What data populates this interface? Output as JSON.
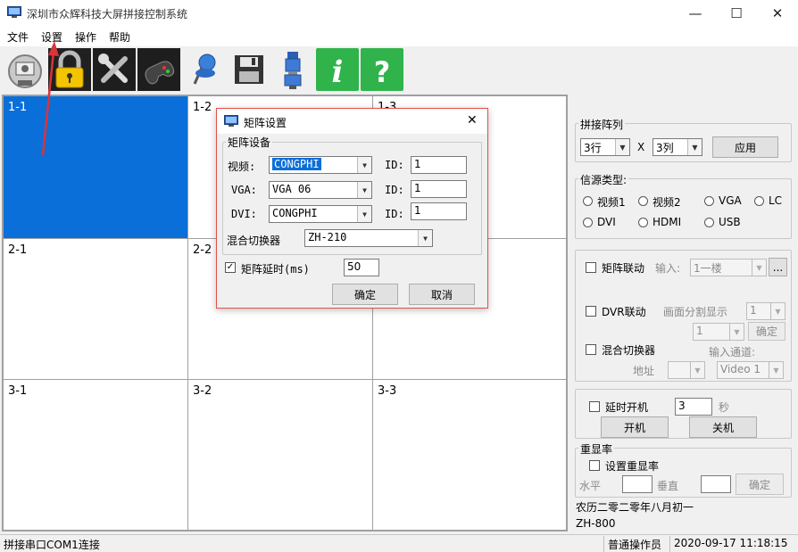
{
  "window": {
    "title": "深圳市众辉科技大屏拼接控制系统",
    "minimize_glyph": "—",
    "maximize_glyph": "☐",
    "close_glyph": "✕"
  },
  "menu": {
    "items": [
      "文件",
      "设置",
      "操作",
      "帮助"
    ]
  },
  "toolbar": {
    "icons": [
      "connect-icon",
      "lock-icon",
      "tools-icon",
      "gamepad-icon",
      "pin-icon",
      "save-icon",
      "serial-port-icon",
      "info-icon",
      "help-icon"
    ],
    "info_glyph": "i",
    "help_glyph": "?"
  },
  "grid": {
    "rows": [
      [
        "1-1",
        "1-2",
        "1-3"
      ],
      [
        "2-1",
        "2-2",
        "2-3"
      ],
      [
        "3-1",
        "3-2",
        "3-3"
      ]
    ],
    "selected": "1-1"
  },
  "panel": {
    "splice": {
      "title": "拼接阵列",
      "rows_value": "3行",
      "times": "X",
      "cols_value": "3列",
      "apply_label": "应用"
    },
    "source": {
      "title": "信源类型:",
      "options": [
        "视频1",
        "视频2",
        "VGA",
        "LC",
        "DVI",
        "HDMI",
        "USB"
      ]
    },
    "matrix_link": {
      "label": "矩阵联动",
      "input_label": "输入:",
      "input_value": "1一楼",
      "more_label": "..."
    },
    "dvr": {
      "label": "DVR联动",
      "split_label": "画面分割显示",
      "split_value": "1",
      "channel_value": "1",
      "confirm_label": "确定"
    },
    "mixer": {
      "label": "混合切换器",
      "channel_label": "输入通道:",
      "address_label": "地址",
      "address_value": "",
      "channel_value": "Video 1"
    },
    "delay": {
      "label": "延时开机",
      "value": "3",
      "unit": "秒",
      "on_label": "开机",
      "off_label": "关机"
    },
    "refresh": {
      "title": "重显率",
      "label": "设置重显率",
      "h_label": "水平",
      "v_label": "垂直",
      "h_value": "",
      "v_value": "",
      "confirm_label": "确定"
    },
    "lunar_date": "农历二零二零年八月初一",
    "model": "ZH-800"
  },
  "dialog": {
    "title": "矩阵设置",
    "close_glyph": "✕",
    "group_title": "矩阵设备",
    "video_label": "视频:",
    "video_value": "CONGPHI",
    "vga_label": "VGA:",
    "vga_value": "VGA 06",
    "dvi_label": "DVI:",
    "dvi_value": "CONGPHI",
    "id_label": "ID:",
    "video_id": "1",
    "vga_id": "1",
    "dvi_id": "1",
    "mixer_label": "混合切换器",
    "mixer_value": "ZH-210",
    "delay_label": "矩阵延时(ms)",
    "delay_value": "50",
    "ok_label": "确定",
    "cancel_label": "取消"
  },
  "status": {
    "connection": "拼接串口COM1连接",
    "user": "普通操作员",
    "datetime": "2020-09-17 11:18:15"
  },
  "colors": {
    "selection": "#0a6fd8",
    "annotation_arrow": "#d9343a",
    "dialog_border": "#e0524a"
  }
}
